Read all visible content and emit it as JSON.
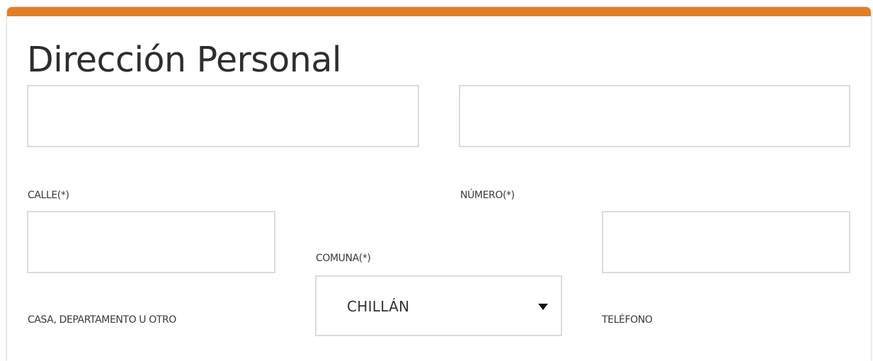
{
  "section": {
    "title": "Dirección Personal",
    "accent_color": "#e07f28"
  },
  "fields": {
    "top_left": {
      "value": ""
    },
    "top_right": {
      "value": ""
    },
    "calle": {
      "label": "CALLE(*)",
      "value": ""
    },
    "numero": {
      "label": "NÚMERO(*)",
      "value": ""
    },
    "casa": {
      "label": "CASA, DEPARTAMENTO U OTRO"
    },
    "comuna": {
      "label": "COMUNA(*)",
      "selected": "CHILLÁN",
      "icon": "caret-down-icon"
    },
    "telefono": {
      "label": "TELÉFONO"
    }
  }
}
